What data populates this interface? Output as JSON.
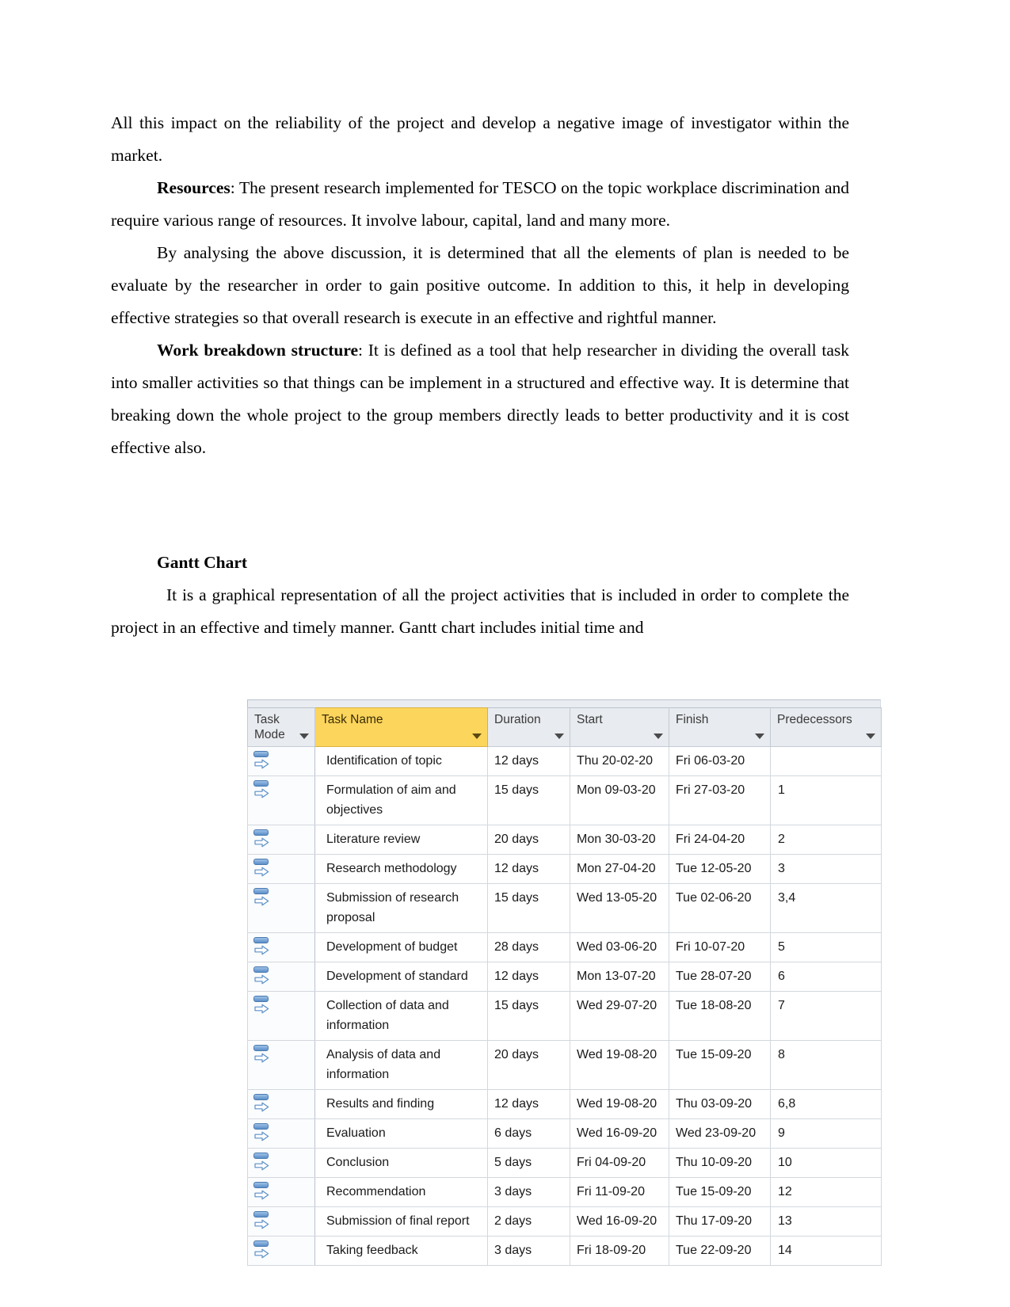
{
  "document": {
    "paragraphs": [
      {
        "id": "p1",
        "style": "plain",
        "text": "All this impact on the reliability of the project and develop a negative image of investigator within the market."
      },
      {
        "id": "p2",
        "style": "lead",
        "lead": "Resources",
        "text": ": The present research implemented for TESCO on the topic workplace discrimination and require various range of resources. It involve labour, capital, land and many more."
      },
      {
        "id": "p3",
        "style": "indent",
        "text": "By analysing the above discussion, it is determined that all the elements of plan is needed to be evaluate by the researcher in order to gain positive outcome. In addition to this, it help in developing effective strategies so that overall research is execute in an effective and rightful manner."
      },
      {
        "id": "p4",
        "style": "lead",
        "lead": "Work breakdown structure",
        "text": ": It is defined as a tool that help researcher in dividing the overall task into smaller activities so that things can be implement in a structured and effective way. It is determine that breaking down the whole project to the group members directly leads to better productivity and it is cost effective also."
      }
    ],
    "gantt_heading": "Gantt Chart",
    "gantt_intro": "It is a graphical representation of all the project activities that is included in order to complete the project in an effective and timely manner. Gantt chart includes initial time and"
  },
  "gantt_table": {
    "columns": [
      {
        "key": "mode",
        "label": "Task Mode",
        "highlight": false,
        "has_filter": true
      },
      {
        "key": "name",
        "label": "Task Name",
        "highlight": true,
        "has_filter": true
      },
      {
        "key": "dur",
        "label": "Duration",
        "highlight": false,
        "has_filter": true
      },
      {
        "key": "start",
        "label": "Start",
        "highlight": false,
        "has_filter": true
      },
      {
        "key": "fin",
        "label": "Finish",
        "highlight": false,
        "has_filter": true
      },
      {
        "key": "pred",
        "label": "Predecessors",
        "highlight": false,
        "has_filter": true
      }
    ],
    "accent_highlight_color": "#fcd55d",
    "header_background_color": "#e8ebef",
    "task_mode_icon": "auto-scheduled-icon",
    "rows": [
      {
        "name": "Identification of topic",
        "duration": "12 days",
        "start": "Thu 20-02-20",
        "finish": "Fri 06-03-20",
        "predecessors": ""
      },
      {
        "name": "Formulation of aim and objectives",
        "duration": "15 days",
        "start": "Mon 09-03-20",
        "finish": "Fri 27-03-20",
        "predecessors": "1"
      },
      {
        "name": "Literature review",
        "duration": "20 days",
        "start": "Mon 30-03-20",
        "finish": "Fri 24-04-20",
        "predecessors": "2"
      },
      {
        "name": "Research methodology",
        "duration": "12 days",
        "start": "Mon 27-04-20",
        "finish": "Tue 12-05-20",
        "predecessors": "3"
      },
      {
        "name": "Submission of research proposal",
        "duration": "15 days",
        "start": "Wed 13-05-20",
        "finish": "Tue 02-06-20",
        "predecessors": "3,4"
      },
      {
        "name": "Development of budget",
        "duration": "28 days",
        "start": "Wed 03-06-20",
        "finish": "Fri 10-07-20",
        "predecessors": "5"
      },
      {
        "name": "Development of standard",
        "duration": "12 days",
        "start": "Mon 13-07-20",
        "finish": "Tue 28-07-20",
        "predecessors": "6"
      },
      {
        "name": "Collection of data and information",
        "duration": "15 days",
        "start": "Wed 29-07-20",
        "finish": "Tue 18-08-20",
        "predecessors": "7"
      },
      {
        "name": "Analysis of data and information",
        "duration": "20 days",
        "start": "Wed 19-08-20",
        "finish": "Tue 15-09-20",
        "predecessors": "8"
      },
      {
        "name": "Results and finding",
        "duration": "12 days",
        "start": "Wed 19-08-20",
        "finish": "Thu 03-09-20",
        "predecessors": "6,8"
      },
      {
        "name": "Evaluation",
        "duration": "6 days",
        "start": "Wed 16-09-20",
        "finish": "Wed 23-09-20",
        "predecessors": "9"
      },
      {
        "name": "Conclusion",
        "duration": "5 days",
        "start": "Fri 04-09-20",
        "finish": "Thu 10-09-20",
        "predecessors": "10"
      },
      {
        "name": "Recommendation",
        "duration": "3 days",
        "start": "Fri 11-09-20",
        "finish": "Tue 15-09-20",
        "predecessors": "12"
      },
      {
        "name": "Submission of final report",
        "duration": "2 days",
        "start": "Wed 16-09-20",
        "finish": "Thu 17-09-20",
        "predecessors": "13"
      },
      {
        "name": "Taking feedback",
        "duration": "3 days",
        "start": "Fri 18-09-20",
        "finish": "Tue 22-09-20",
        "predecessors": "14"
      }
    ]
  }
}
